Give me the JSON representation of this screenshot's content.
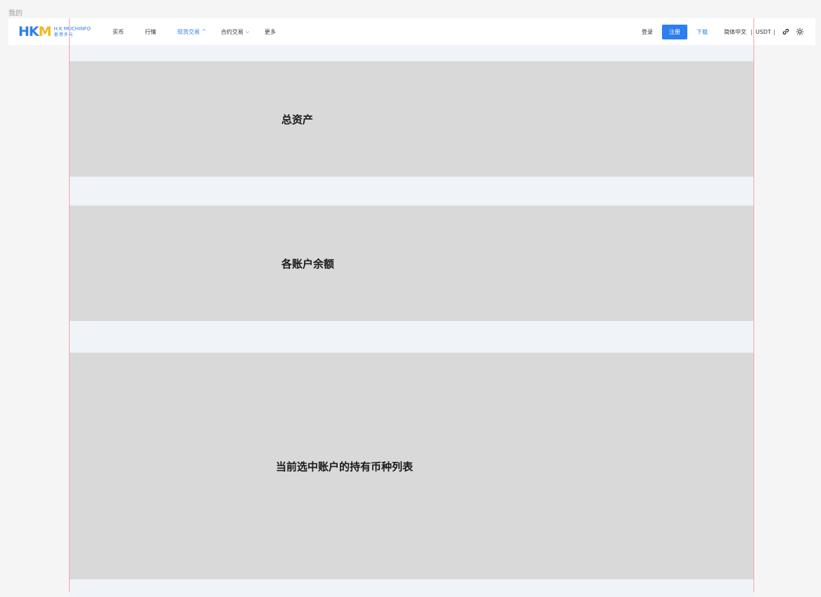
{
  "page": {
    "label": "我的"
  },
  "logo": {
    "mark_h": "H",
    "mark_k": "K",
    "mark_m": "M",
    "en": "H.K MUCHINFO",
    "cn": "香港多元"
  },
  "nav": {
    "items": [
      {
        "label": "买币"
      },
      {
        "label": "行情"
      },
      {
        "label": "现货交易",
        "active": true
      },
      {
        "label": "合约交易"
      },
      {
        "label": "更多"
      }
    ],
    "login": "登录",
    "register": "注册",
    "download": "下载",
    "language": "简体中文",
    "currency": "USDT",
    "separator": "|",
    "accent_color": "#2d7ff0"
  },
  "icons": {
    "language_caret": "chevron-up",
    "futures_caret": "chevron-down",
    "link": "link-icon",
    "theme": "sun-icon"
  },
  "sections": [
    {
      "label": "总资产"
    },
    {
      "label": "各账户余额"
    },
    {
      "label": "当前选中账户的持有币种列表"
    }
  ]
}
